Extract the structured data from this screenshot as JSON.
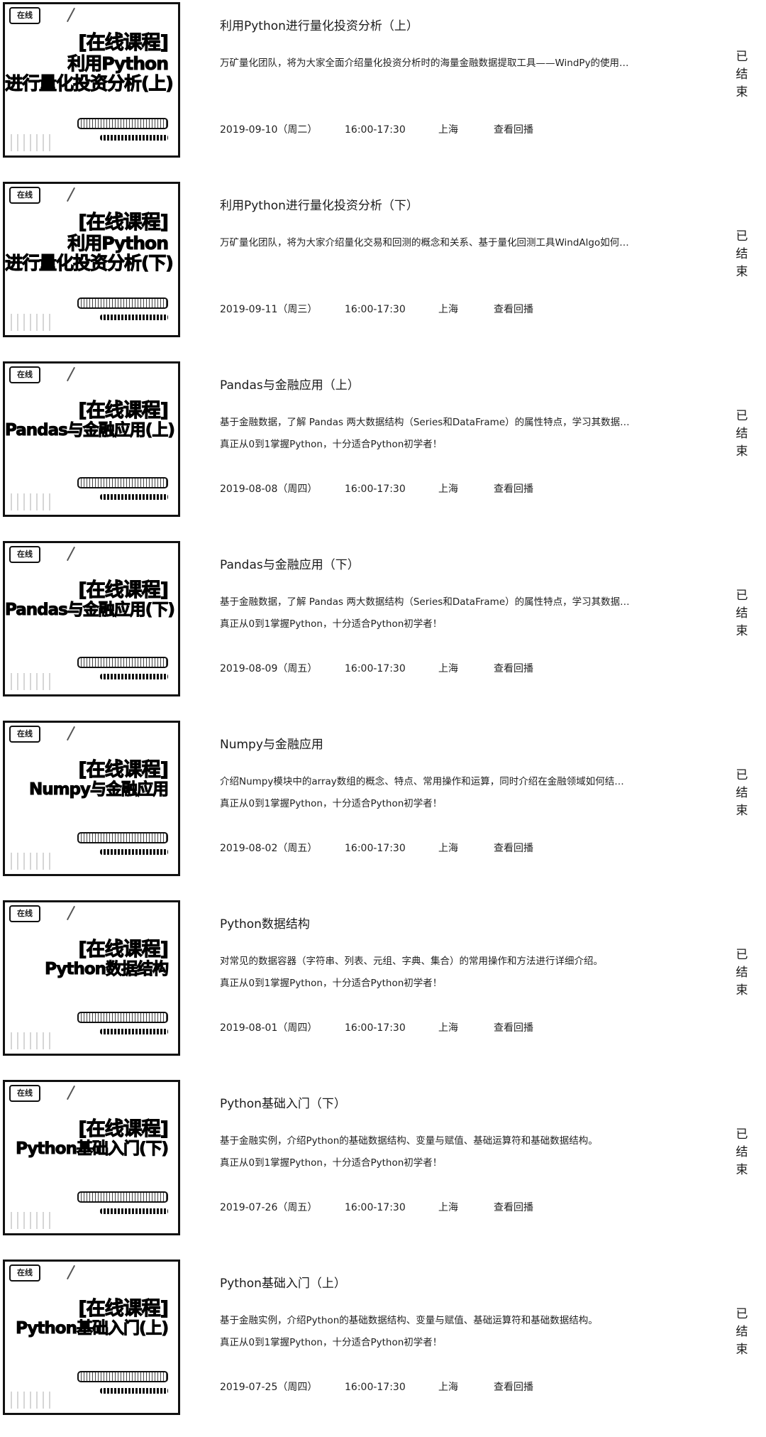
{
  "courses": [
    {
      "thumb": {
        "badge": "在线",
        "lines": [
          "[在线课程]",
          "利用Python",
          "进行量化投资分析(上)"
        ]
      },
      "title": "利用Python进行量化投资分析（上）",
      "desc": [
        "万矿量化团队，将为大家全面介绍量化投资分析时的海量金融数据提取工具——WindPy的使用…"
      ],
      "date": "2019-09-10（周二）",
      "time": "16:00-17:30",
      "city": "上海",
      "replay": "查看回播",
      "status": "已结束"
    },
    {
      "thumb": {
        "badge": "在线",
        "lines": [
          "[在线课程]",
          "利用Python",
          "进行量化投资分析(下)"
        ]
      },
      "title": "利用Python进行量化投资分析（下）",
      "desc": [
        "万矿量化团队，将为大家介绍量化交易和回测的概念和关系、基于量化回测工具WindAlgo如何…"
      ],
      "date": "2019-09-11（周三）",
      "time": "16:00-17:30",
      "city": "上海",
      "replay": "查看回播",
      "status": "已结束"
    },
    {
      "thumb": {
        "badge": "在线",
        "lines": [
          "[在线课程]",
          "Pandas与金融应用(上)"
        ]
      },
      "title": "Pandas与金融应用（上）",
      "desc": [
        "基于金融数据，了解 Pandas 两大数据结构（Series和DataFrame）的属性特点，学习其数据…",
        "真正从0到1掌握Python，十分适合Python初学者！"
      ],
      "date": "2019-08-08（周四）",
      "time": "16:00-17:30",
      "city": "上海",
      "replay": "查看回播",
      "status": "已结束"
    },
    {
      "thumb": {
        "badge": "在线",
        "lines": [
          "[在线课程]",
          "Pandas与金融应用(下)"
        ]
      },
      "title": "Pandas与金融应用（下）",
      "desc": [
        "基于金融数据，了解 Pandas 两大数据结构（Series和DataFrame）的属性特点，学习其数据…",
        "真正从0到1掌握Python，十分适合Python初学者！"
      ],
      "date": "2019-08-09（周五）",
      "time": "16:00-17:30",
      "city": "上海",
      "replay": "查看回播",
      "status": "已结束"
    },
    {
      "thumb": {
        "badge": "在线",
        "lines": [
          "[在线课程]",
          "Numpy与金融应用"
        ]
      },
      "title": "Numpy与金融应用",
      "desc": [
        "介绍Numpy模块中的array数组的概念、特点、常用操作和运算，同时介绍在金融领域如何结…",
        "真正从0到1掌握Python，十分适合Python初学者！"
      ],
      "date": "2019-08-02（周五）",
      "time": "16:00-17:30",
      "city": "上海",
      "replay": "查看回播",
      "status": "已结束"
    },
    {
      "thumb": {
        "badge": "在线",
        "lines": [
          "[在线课程]",
          "Python数据结构"
        ]
      },
      "title": "Python数据结构",
      "desc": [
        "对常见的数据容器（字符串、列表、元组、字典、集合）的常用操作和方法进行详细介绍。",
        "真正从0到1掌握Python，十分适合Python初学者！"
      ],
      "date": "2019-08-01（周四）",
      "time": "16:00-17:30",
      "city": "上海",
      "replay": "查看回播",
      "status": "已结束"
    },
    {
      "thumb": {
        "badge": "在线",
        "lines": [
          "[在线课程]",
          "Python基础入门(下)"
        ]
      },
      "title": "Python基础入门（下）",
      "desc": [
        "基于金融实例，介绍Python的基础数据结构、变量与赋值、基础运算符和基础数据结构。",
        "真正从0到1掌握Python，十分适合Python初学者！"
      ],
      "date": "2019-07-26（周五）",
      "time": "16:00-17:30",
      "city": "上海",
      "replay": "查看回播",
      "status": "已结束"
    },
    {
      "thumb": {
        "badge": "在线",
        "lines": [
          "[在线课程]",
          "Python基础入门(上)"
        ]
      },
      "title": "Python基础入门（上）",
      "desc": [
        "基于金融实例，介绍Python的基础数据结构、变量与赋值、基础运算符和基础数据结构。",
        "真正从0到1掌握Python，十分适合Python初学者！"
      ],
      "date": "2019-07-25（周四）",
      "time": "16:00-17:30",
      "city": "上海",
      "replay": "查看回播",
      "status": "已结束"
    }
  ]
}
